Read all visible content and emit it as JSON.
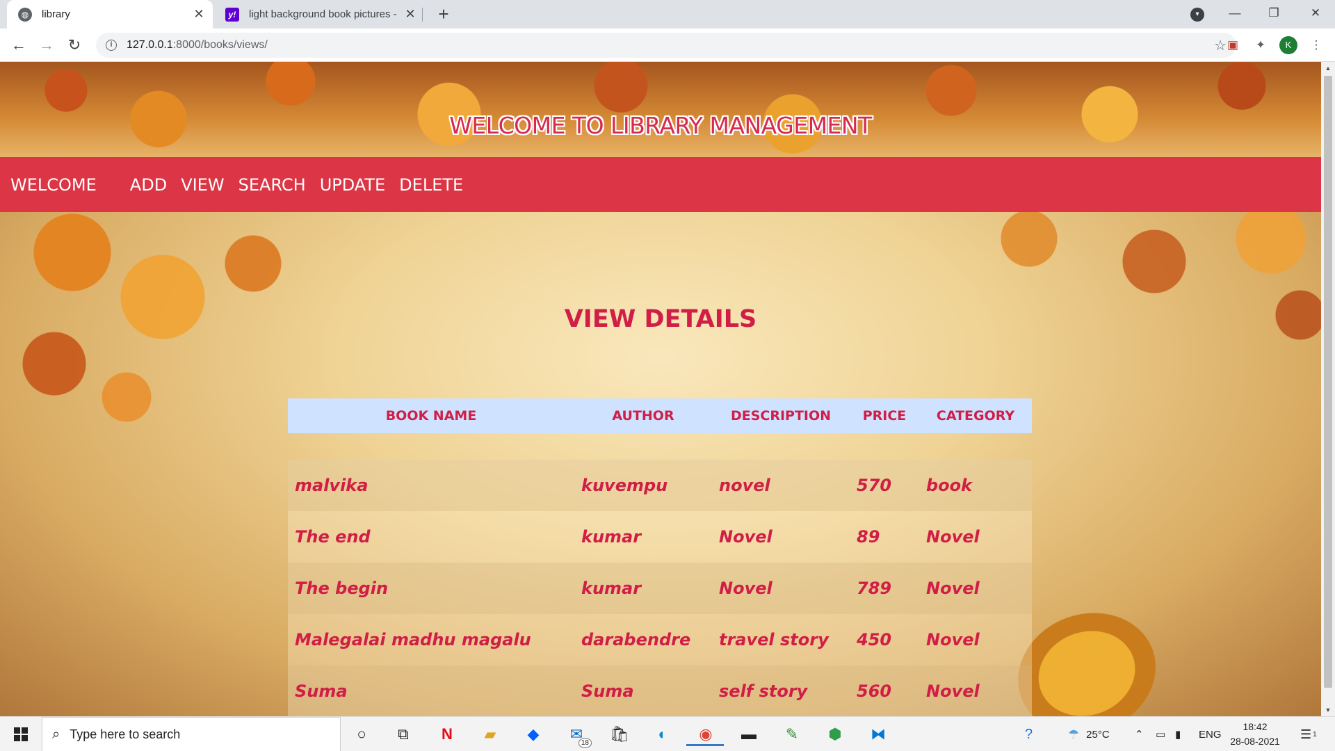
{
  "browser": {
    "tabs": [
      {
        "title": "library",
        "active": true
      },
      {
        "title": "light background book pictures -",
        "active": false
      }
    ],
    "new_tab_label": "+",
    "url_host": "127.0.0.1",
    "url_rest": ":8000/books/views/",
    "profile_initial": "K"
  },
  "site": {
    "title": "WELCOME TO LIBRARY MANAGEMENT",
    "nav": {
      "brand": "WELCOME",
      "links": [
        "ADD",
        "VIEW",
        "SEARCH",
        "UPDATE",
        "DELETE"
      ]
    },
    "heading": "VIEW DETAILS"
  },
  "table": {
    "headers": [
      "BOOK NAME",
      "AUTHOR",
      "DESCRIPTION",
      "PRICE",
      "CATEGORY"
    ],
    "rows": [
      [
        "malvika",
        "kuvempu",
        "novel",
        "570",
        "book"
      ],
      [
        "The end",
        "kumar",
        "Novel",
        "89",
        "Novel"
      ],
      [
        "The begin",
        "kumar",
        "Novel",
        "789",
        "Novel"
      ],
      [
        "Malegalai madhu magalu",
        "darabendre",
        "travel story",
        "450",
        "Novel"
      ],
      [
        "Suma",
        "Suma",
        "self story",
        "560",
        "Novel"
      ]
    ]
  },
  "taskbar": {
    "search_placeholder": "Type here to search",
    "mail_badge": "18",
    "weather": "25°C",
    "language": "ENG",
    "time": "18:42",
    "date": "28-08-2021",
    "notification_count": "1"
  },
  "colors": {
    "navbar": "#dc3545",
    "accent_text": "#d01e46",
    "table_header_bg": "#cfe2ff"
  }
}
